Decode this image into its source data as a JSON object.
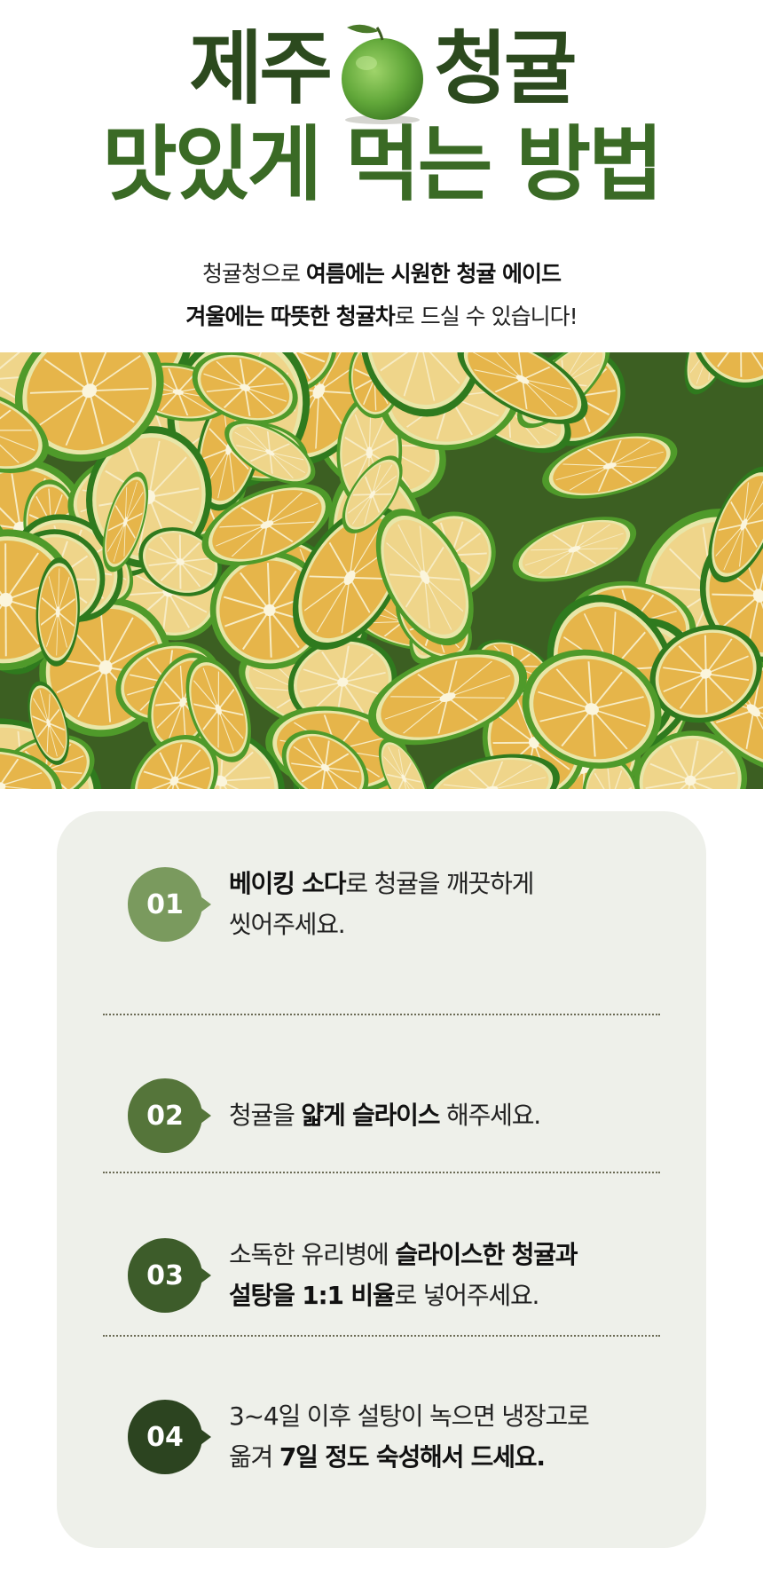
{
  "header": {
    "title_word_1": "제주",
    "title_word_2": "청귤",
    "title_line_2": "맛있게 먹는 방법",
    "subtitle_line_1": [
      {
        "text": "청귤청으로 ",
        "bold": false
      },
      {
        "text": "여름에는 시원한 청귤 에이드",
        "bold": true
      }
    ],
    "subtitle_line_2": [
      {
        "text": "겨울에는 따뜻한 청귤차",
        "bold": true
      },
      {
        "text": "로 드실 수 있습니다!",
        "bold": false
      }
    ]
  },
  "colors": {
    "title_dark": "#2c4a1e",
    "title_green": "#3a6a25",
    "card_bg": "#eef0ea",
    "badge_1": "#7a9a5e",
    "badge_2": "#55753a",
    "badge_3": "#3d5c2a",
    "badge_4": "#2c4420"
  },
  "photo": {
    "icon": "green-tangerine-slices-photo"
  },
  "steps": [
    {
      "number": "01",
      "lines": [
        [
          {
            "text": "베이킹 소다",
            "bold": true
          },
          {
            "text": "로 청귤을 깨끗하게",
            "bold": false
          }
        ],
        [
          {
            "text": "씻어주세요.",
            "bold": false
          }
        ]
      ]
    },
    {
      "number": "02",
      "lines": [
        [
          {
            "text": "청귤을 ",
            "bold": false
          },
          {
            "text": "얇게 슬라이스",
            "bold": true
          },
          {
            "text": " 해주세요.",
            "bold": false
          }
        ]
      ]
    },
    {
      "number": "03",
      "lines": [
        [
          {
            "text": "소독한 유리병에 ",
            "bold": false
          },
          {
            "text": "슬라이스한 청귤과",
            "bold": true
          }
        ],
        [
          {
            "text": "설탕을 1:1 비율",
            "bold": true
          },
          {
            "text": "로 넣어주세요.",
            "bold": false
          }
        ]
      ]
    },
    {
      "number": "04",
      "lines": [
        [
          {
            "text": "3~4일 이후 설탕이 녹으면 냉장고로",
            "bold": false
          }
        ],
        [
          {
            "text": "옮겨 ",
            "bold": false
          },
          {
            "text": "7일 정도 숙성해서 드세요.",
            "bold": true
          }
        ]
      ]
    }
  ]
}
